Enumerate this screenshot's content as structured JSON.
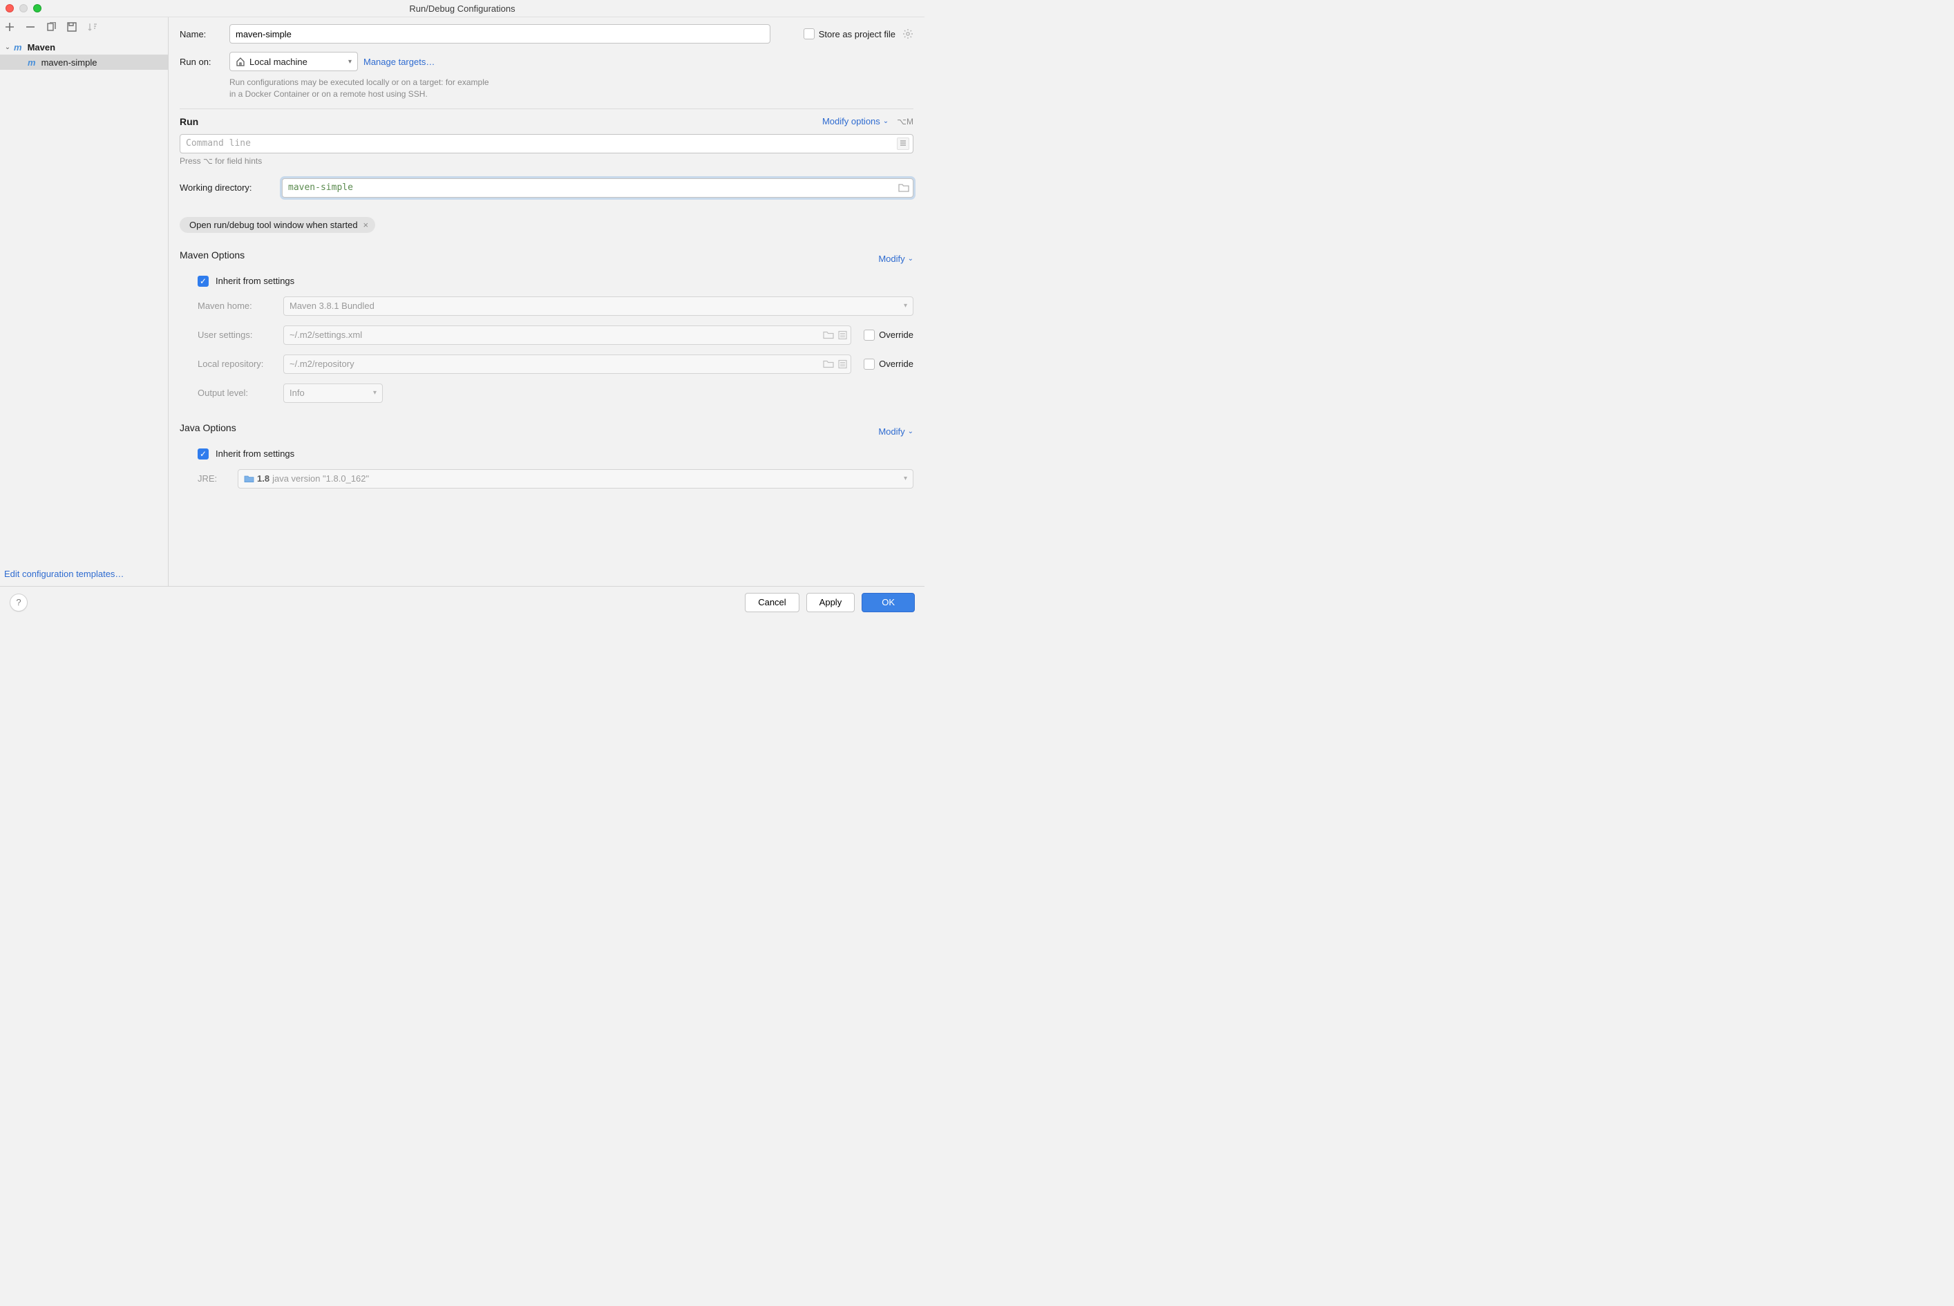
{
  "window": {
    "title": "Run/Debug Configurations"
  },
  "sidebar": {
    "tree": {
      "root": {
        "label": "Maven",
        "expanded": true
      },
      "child": {
        "label": "maven-simple",
        "selected": true
      }
    },
    "edit_templates": "Edit configuration templates…"
  },
  "form": {
    "name_label": "Name:",
    "name_value": "maven-simple",
    "store_label": "Store as project file",
    "runon_label": "Run on:",
    "runon_value": "Local machine",
    "manage_targets": "Manage targets…",
    "help_line1": "Run configurations may be executed locally or on a target: for example",
    "help_line2": "in a Docker Container or on a remote host using SSH."
  },
  "run": {
    "title": "Run",
    "modify_options": "Modify options",
    "shortcut": "⌥M",
    "command_placeholder": "Command line",
    "hint": "Press ⌥ for field hints",
    "working_dir_label": "Working directory:",
    "working_dir_value": "maven-simple",
    "chip": "Open run/debug tool window when started"
  },
  "maven": {
    "title": "Maven Options",
    "modify": "Modify",
    "inherit_label": "Inherit from settings",
    "home_label": "Maven home:",
    "home_value": "Maven 3.8.1 Bundled",
    "user_settings_label": "User settings:",
    "user_settings_value": "~/.m2/settings.xml",
    "local_repo_label": "Local repository:",
    "local_repo_value": "~/.m2/repository",
    "output_label": "Output level:",
    "output_value": "Info",
    "override": "Override"
  },
  "java": {
    "title": "Java Options",
    "modify": "Modify",
    "inherit_label": "Inherit from settings",
    "jre_label": "JRE:",
    "jre_value": "1.8",
    "jre_desc": "java version \"1.8.0_162\""
  },
  "footer": {
    "cancel": "Cancel",
    "apply": "Apply",
    "ok": "OK"
  }
}
